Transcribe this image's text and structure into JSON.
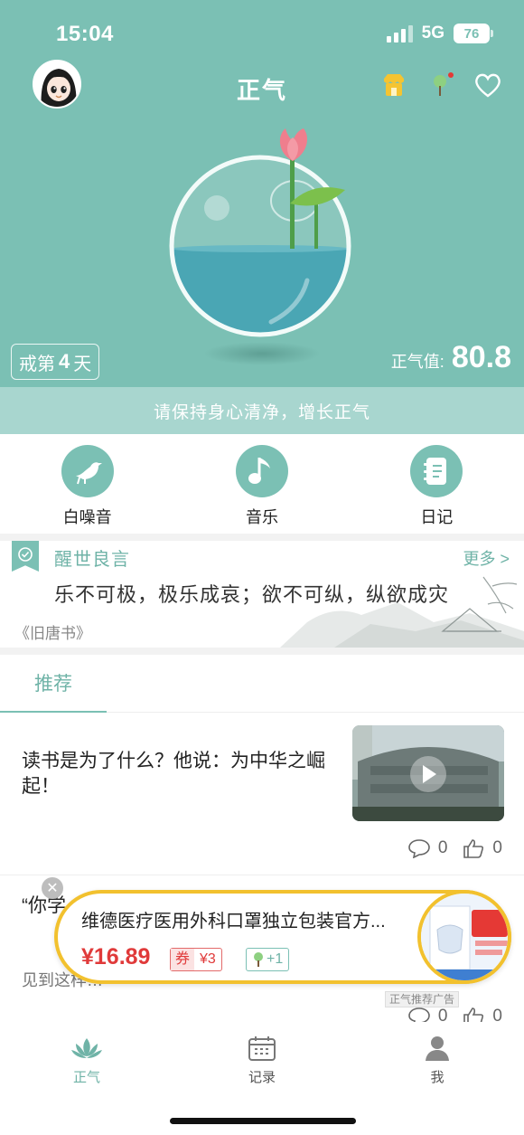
{
  "status_bar": {
    "time": "15:04",
    "network": "5G",
    "battery": "76"
  },
  "header": {
    "title": "正气"
  },
  "hero": {
    "days_prefix": "戒第",
    "days_count": "4",
    "days_suffix": "天",
    "score_label": "正气值:",
    "score_value": "80.8",
    "banner": "请保持身心清净，增长正气"
  },
  "tools": [
    {
      "label": "白噪音",
      "icon": "bird-icon"
    },
    {
      "label": "音乐",
      "icon": "music-note-icon"
    },
    {
      "label": "日记",
      "icon": "notebook-icon"
    }
  ],
  "quote": {
    "title": "醒世良言",
    "more": "更多 >",
    "text": "乐不可极，极乐成哀；欲不可纵，纵欲成灾",
    "source": "《旧唐书》"
  },
  "tabs": {
    "recommend": "推荐"
  },
  "articles": [
    {
      "headline": "读书是为了什么？他说：为中华之崛起！",
      "comments": "0",
      "likes": "0"
    },
    {
      "headline": "“你学…己教…",
      "preview": "见到这样…",
      "comments": "0",
      "likes": "0"
    }
  ],
  "ad": {
    "name": "维德医疗医用外科口罩独立包装官方...",
    "price": "¥16.89",
    "coupon_label": "券",
    "coupon_value": "¥3",
    "plus": "+1",
    "tag": "正气推荐广告"
  },
  "nav": [
    {
      "label": "正气",
      "icon": "lotus-icon"
    },
    {
      "label": "记录",
      "icon": "calendar-icon"
    },
    {
      "label": "我",
      "icon": "person-icon"
    }
  ],
  "colors": {
    "primary": "#7bc0b4",
    "accent_text": "#6fb3a7",
    "price": "#e03a3a",
    "ad_border": "#f2c12e"
  }
}
